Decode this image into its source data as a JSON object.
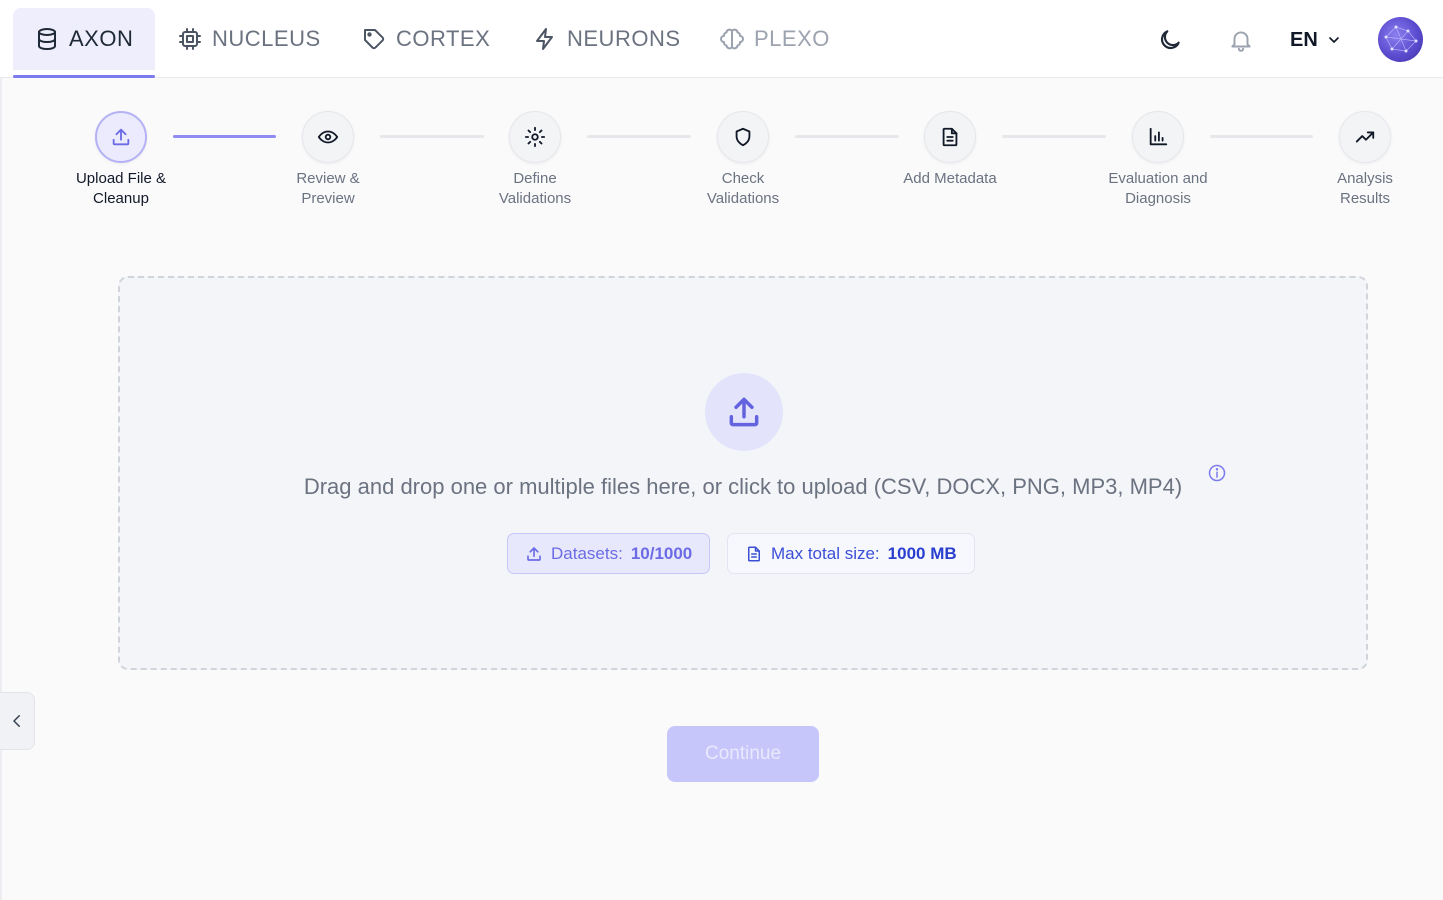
{
  "nav": {
    "tabs": [
      {
        "label": "AXON",
        "icon": "database-icon",
        "active": true
      },
      {
        "label": "NUCLEUS",
        "icon": "cpu-chip-icon",
        "active": false
      },
      {
        "label": "CORTEX",
        "icon": "tag-icon",
        "active": false
      },
      {
        "label": "NEURONS",
        "icon": "lightning-bolt-icon",
        "active": false
      },
      {
        "label": "PLEXO",
        "icon": "brain-icon",
        "active": false
      }
    ],
    "language": "EN",
    "theme_icon": "moon-icon",
    "notification_icon": "bell-icon"
  },
  "stepper": {
    "steps": [
      {
        "label": "Upload File & Cleanup",
        "icon": "upload-icon",
        "active": true
      },
      {
        "label": "Review & Preview",
        "icon": "eye-icon",
        "active": false
      },
      {
        "label": "Define Validations",
        "icon": "gear-icon",
        "active": false
      },
      {
        "label": "Check Validations",
        "icon": "shield-icon",
        "active": false
      },
      {
        "label": "Add Metadata",
        "icon": "document-icon",
        "active": false
      },
      {
        "label": "Evaluation and Diagnosis",
        "icon": "bar-chart-icon",
        "active": false
      },
      {
        "label": "Analysis Results",
        "icon": "trending-up-icon",
        "active": false
      }
    ]
  },
  "dropzone": {
    "text": "Drag and drop one or multiple files here, or click to upload (CSV, DOCX, PNG, MP3, MP4)",
    "datasets_label": "Datasets:",
    "datasets_value": "10/1000",
    "max_size_label": "Max total size:",
    "max_size_value": "1000 MB"
  },
  "actions": {
    "continue_label": "Continue"
  },
  "colors": {
    "accent": "#7c7cf0",
    "accent_light": "#ecebfd",
    "continue_disabled": "#c7c6fa"
  }
}
